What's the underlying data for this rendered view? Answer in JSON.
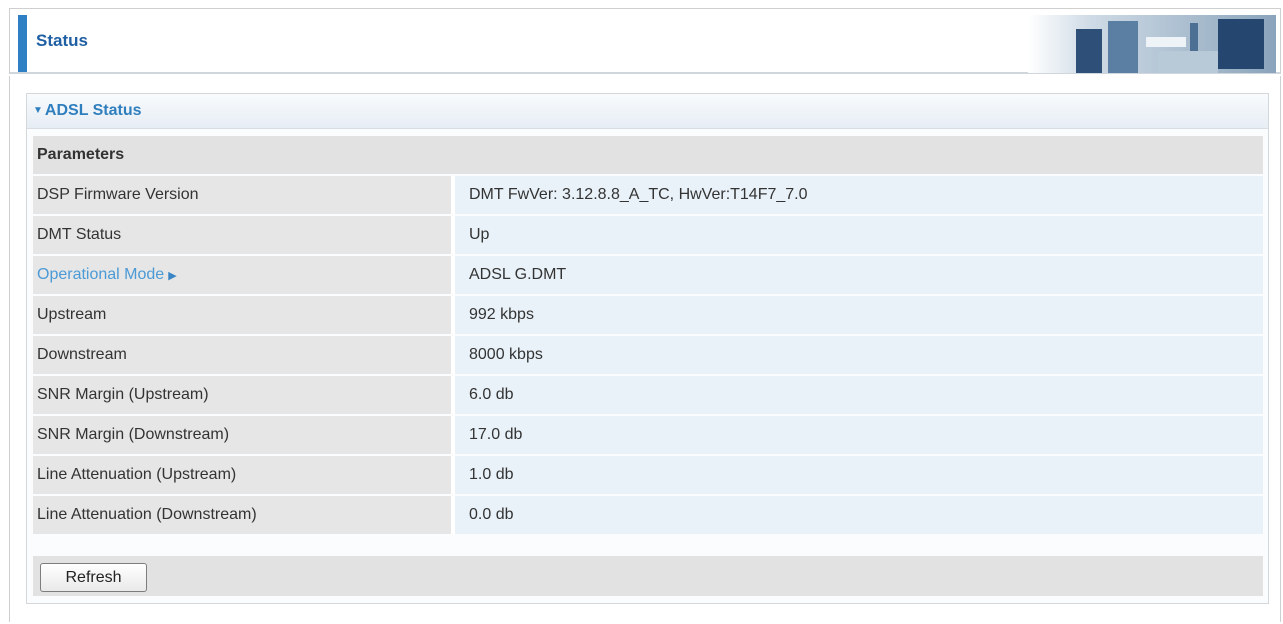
{
  "header": {
    "title": "Status"
  },
  "panel": {
    "title": "ADSL Status",
    "params_header": "Parameters",
    "rows": [
      {
        "label": "DSP Firmware Version",
        "value": "DMT FwVer: 3.12.8.8_A_TC, HwVer:T14F7_7.0"
      },
      {
        "label": "DMT Status",
        "value": "Up"
      },
      {
        "label": "Operational Mode",
        "value": "ADSL G.DMT"
      },
      {
        "label": "Upstream",
        "value": "992 kbps"
      },
      {
        "label": "Downstream",
        "value": "8000 kbps"
      },
      {
        "label": "SNR Margin (Upstream)",
        "value": "6.0 db"
      },
      {
        "label": "SNR Margin (Downstream)",
        "value": "17.0 db"
      },
      {
        "label": "Line Attenuation (Upstream)",
        "value": "1.0 db"
      },
      {
        "label": "Line Attenuation (Downstream)",
        "value": "0.0 db"
      }
    ],
    "refresh_label": "Refresh"
  },
  "colors": {
    "accent": "#2e7fc4",
    "title_text": "#1f5fa3",
    "link": "#4b9ad6"
  },
  "icons": {
    "collapse": "triangle-down-icon",
    "link_arrow": "triangle-right-icon"
  }
}
